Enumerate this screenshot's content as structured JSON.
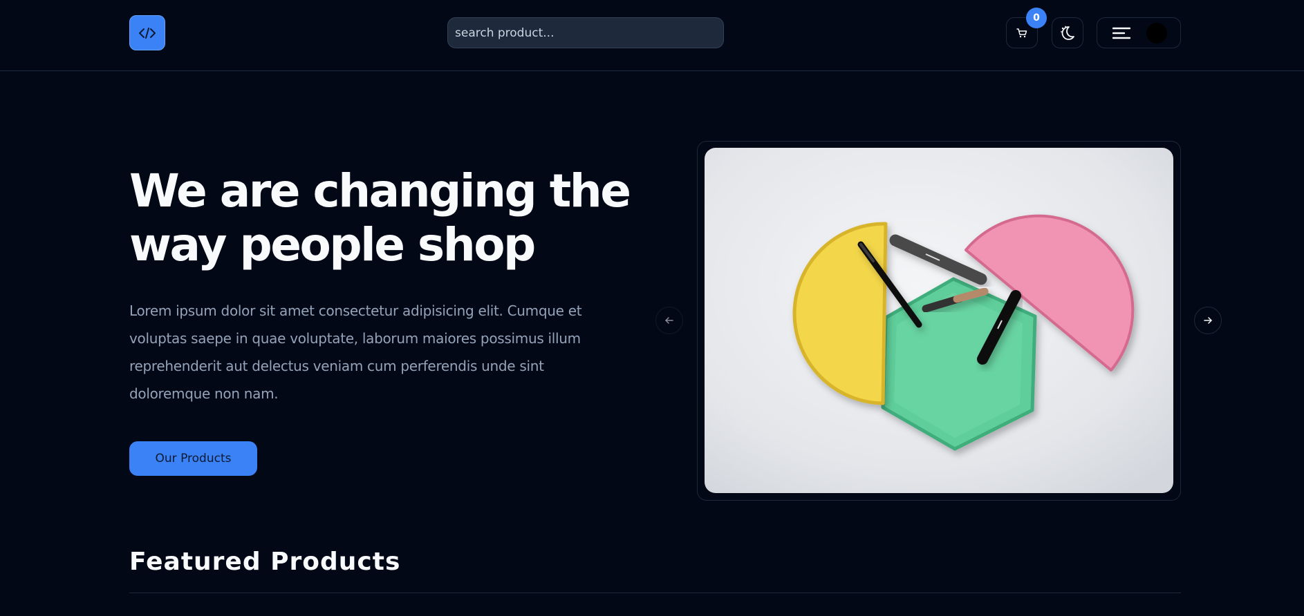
{
  "header": {
    "search_placeholder": "search product...",
    "cart_count": "0"
  },
  "hero": {
    "title": "We are changing the way people shop",
    "description": "Lorem ipsum dolor sit amet consectetur adipisicing elit. Cumque et voluptas saepe in quae voluptate, laborum maiores possimus illum reprehenderit aut delectus veniam cum perferendis unde sint doloremque non nam.",
    "cta_label": "Our Products"
  },
  "featured": {
    "title": "Featured Products"
  },
  "icons": {
    "logo": "code-icon",
    "cart": "cart-icon",
    "theme": "moon-stars-icon",
    "menu": "hamburger-menu-icon",
    "prev": "arrow-left-icon",
    "next": "arrow-right-icon"
  },
  "colors": {
    "background": "#030817",
    "accent": "#3b82f6",
    "border": "#1e293b",
    "muted_text": "#94a3b8"
  }
}
